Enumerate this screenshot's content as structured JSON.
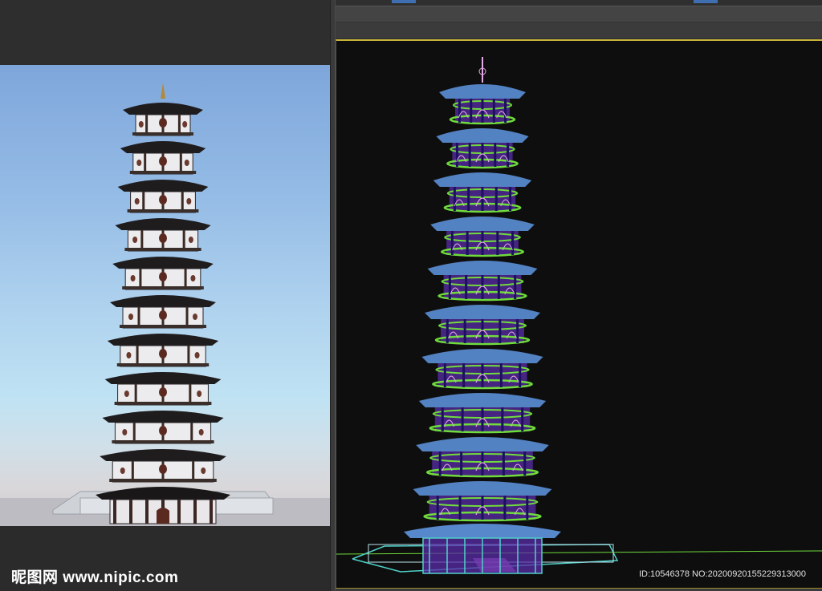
{
  "watermark": {
    "logo_text": "昵图网",
    "url_text": "www.nipic.com",
    "id_text": "ID:10546378 NO:20200920155229313000"
  },
  "colors": {
    "sky_top": "#7ea6db",
    "viewport_bg": "#0e0e0e",
    "viewport_border": "#c8b43a",
    "wire_blue": "#5b8fd6",
    "wire_green": "#6fdc3c",
    "wire_purple": "#5a2ca8",
    "wire_cyan": "#4fd1c8",
    "wire_pink": "#e6a9e8"
  },
  "icons": {
    "render": "pagoda-render-image",
    "wireframe": "pagoda-wireframe-model"
  }
}
